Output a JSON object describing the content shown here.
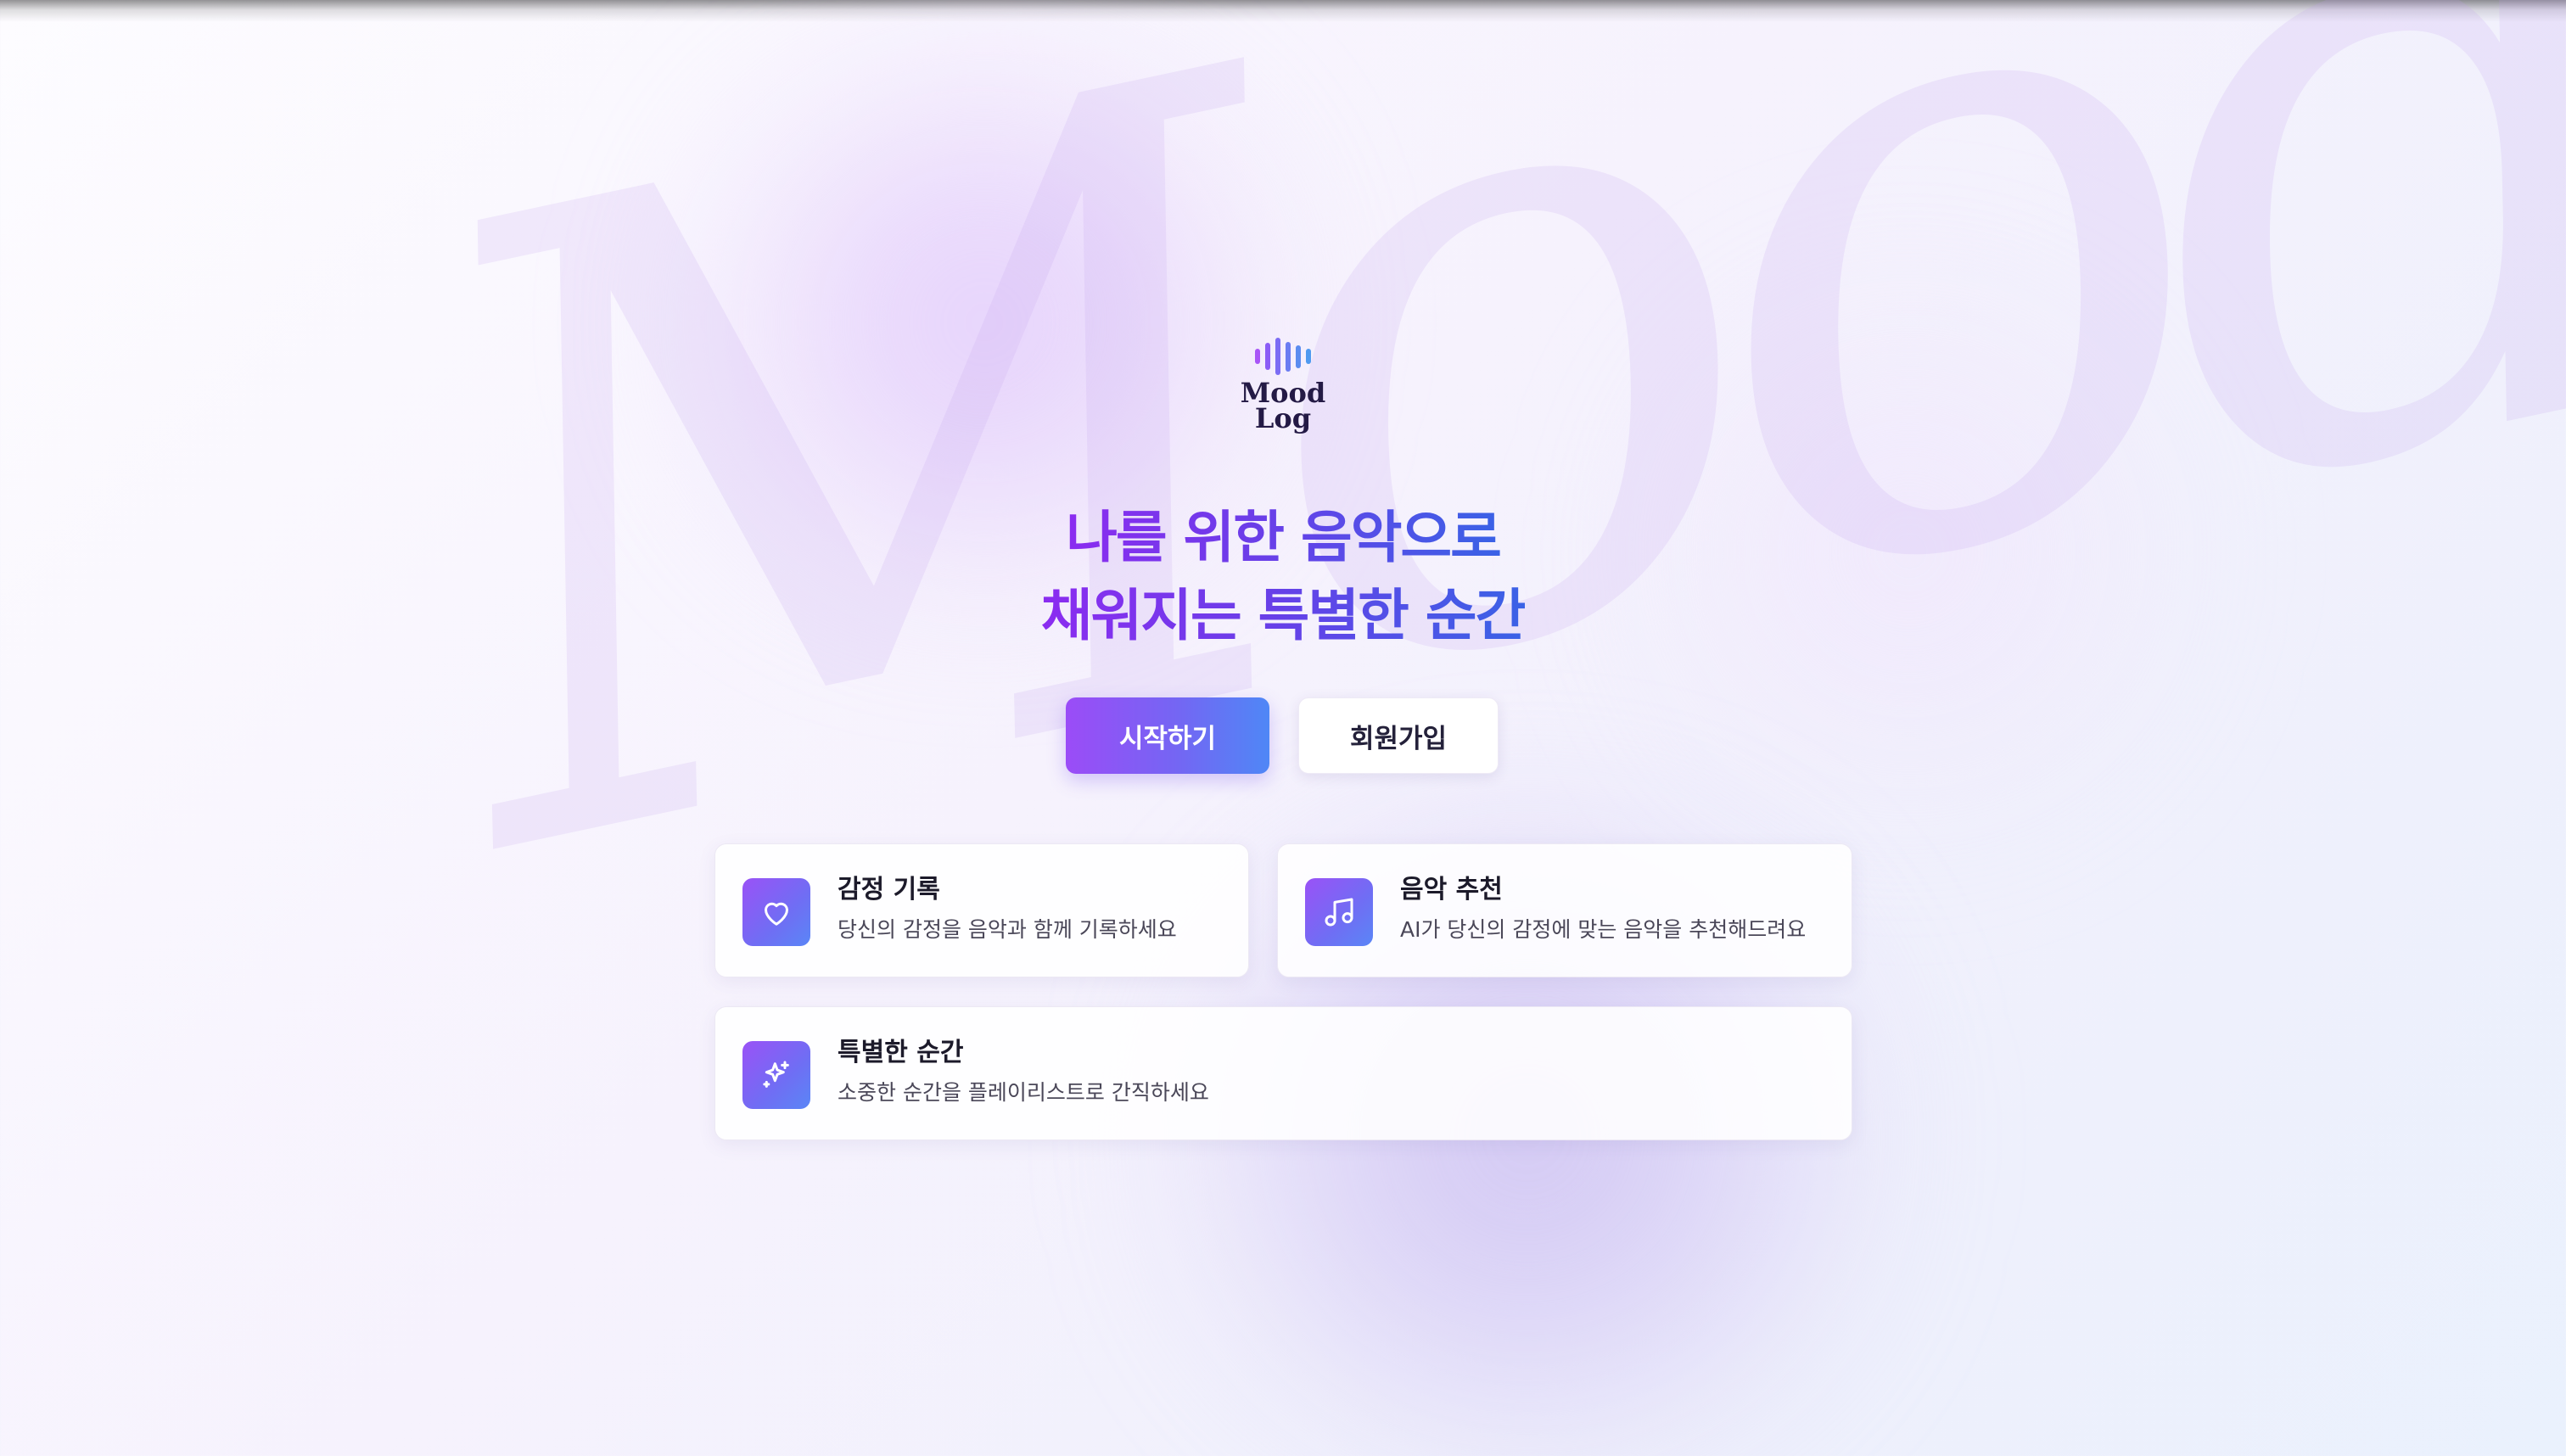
{
  "watermark": "Mood",
  "logo": {
    "line1": "Mood",
    "line2": "Log",
    "bars": [
      {
        "height": 0.42,
        "color": "#a855f7"
      },
      {
        "height": 0.72,
        "color": "#8b5cf6"
      },
      {
        "height": 1.0,
        "color": "#7c6cf4"
      },
      {
        "height": 0.8,
        "color": "#6a7cf2"
      },
      {
        "height": 0.62,
        "color": "#5b8cf0"
      },
      {
        "height": 0.4,
        "color": "#4f9af0"
      }
    ]
  },
  "hero": {
    "line1": "나를 위한 음악으로",
    "line2": "채워지는 특별한 순간"
  },
  "buttons": {
    "start": "시작하기",
    "signup": "회원가입"
  },
  "features": [
    {
      "icon": "heart-icon",
      "title": "감정 기록",
      "desc": "당신의 감정을 음악과 함께 기록하세요"
    },
    {
      "icon": "music-note-icon",
      "title": "음악 추천",
      "desc": "AI가 당신의 감정에 맞는 음악을 추천해드려요"
    },
    {
      "icon": "sparkles-icon",
      "title": "특별한 순간",
      "desc": "소중한 순간을 플레이리스트로 간직하세요"
    }
  ],
  "colors": {
    "accent_purple": "#9b4cf7",
    "accent_blue": "#4f87f6",
    "headline_gradient_start": "#8b2cf0",
    "headline_gradient_end": "#3a62e6"
  }
}
